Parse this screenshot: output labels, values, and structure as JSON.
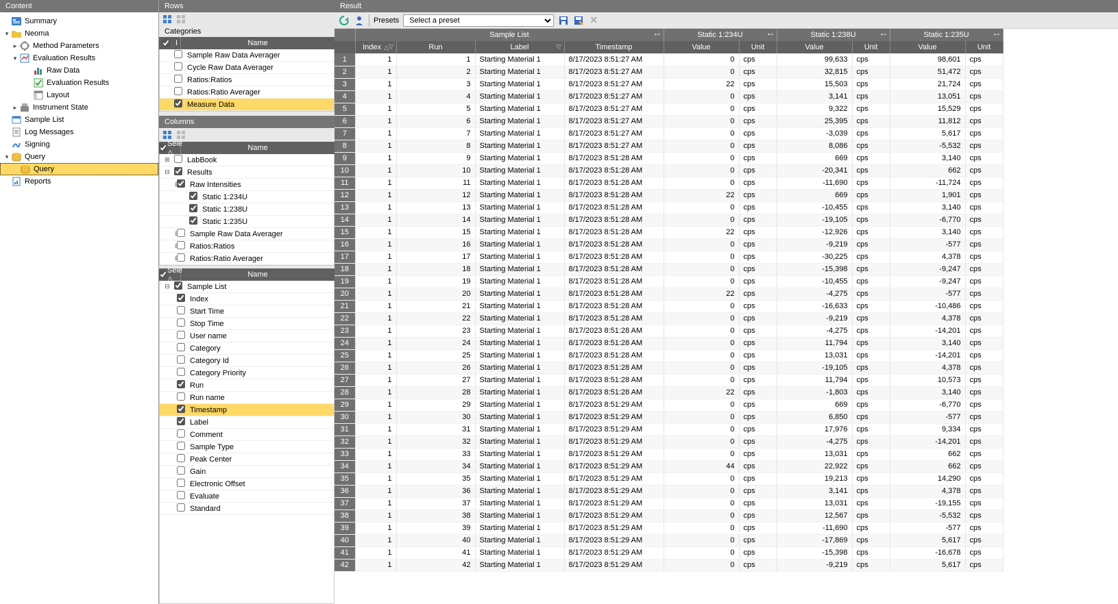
{
  "panels": {
    "content": "Content",
    "rows": "Rows",
    "columns": "Columns",
    "result": "Result"
  },
  "tree": [
    {
      "label": "Summary",
      "depth": 0,
      "icon": "summary",
      "toggle": ""
    },
    {
      "label": "Neoma",
      "depth": 0,
      "icon": "folder",
      "toggle": "▾"
    },
    {
      "label": "Method Parameters",
      "depth": 1,
      "icon": "params",
      "toggle": "▸"
    },
    {
      "label": "Evaluation Results",
      "depth": 1,
      "icon": "eval",
      "toggle": "▾"
    },
    {
      "label": "Raw Data",
      "depth": 2,
      "icon": "chart",
      "toggle": ""
    },
    {
      "label": "Evaluation Results",
      "depth": 2,
      "icon": "eval2",
      "toggle": ""
    },
    {
      "label": "Layout",
      "depth": 2,
      "icon": "layout",
      "toggle": ""
    },
    {
      "label": "Instrument State",
      "depth": 1,
      "icon": "instr",
      "toggle": "▸"
    },
    {
      "label": "Sample List",
      "depth": 0,
      "icon": "sample",
      "toggle": ""
    },
    {
      "label": "Log Messages",
      "depth": 0,
      "icon": "log",
      "toggle": ""
    },
    {
      "label": "Signing",
      "depth": 0,
      "icon": "sign",
      "toggle": ""
    },
    {
      "label": "Query",
      "depth": 0,
      "icon": "query",
      "toggle": "▾"
    },
    {
      "label": "Query",
      "depth": 1,
      "icon": "query2",
      "toggle": "",
      "selected": true
    },
    {
      "label": "Reports",
      "depth": 0,
      "icon": "report",
      "toggle": ""
    }
  ],
  "categories": {
    "title": "Categories",
    "header": {
      "check": "I",
      "name": "Name"
    },
    "rows": [
      {
        "label": "Sample Raw Data Averager",
        "checked": false,
        "sel": false
      },
      {
        "label": "Cycle Raw Data Averager",
        "checked": false,
        "sel": false
      },
      {
        "label": "Ratios:Ratios",
        "checked": false,
        "sel": false
      },
      {
        "label": "Ratios:Ratio Averager",
        "checked": false,
        "sel": false
      },
      {
        "label": "Measure Data",
        "checked": true,
        "sel": true
      }
    ]
  },
  "columns_top": {
    "header": {
      "check": "Sele △",
      "name": "Name"
    },
    "rows": [
      {
        "label": "LabBook",
        "checked": false,
        "expand": "+",
        "ind": 0
      },
      {
        "label": "Results",
        "checked": true,
        "expand": "−",
        "ind": 0
      },
      {
        "label": "Raw Intensities",
        "checked": true,
        "expand": "−",
        "ind": 1
      },
      {
        "label": "Static 1:234U",
        "checked": true,
        "expand": "",
        "ind": 2
      },
      {
        "label": "Static 1:238U",
        "checked": true,
        "expand": "",
        "ind": 2
      },
      {
        "label": "Static 1:235U",
        "checked": true,
        "expand": "",
        "ind": 2
      },
      {
        "label": "Sample Raw Data Averager",
        "checked": false,
        "expand": "+",
        "ind": 1
      },
      {
        "label": "Ratios:Ratios",
        "checked": false,
        "expand": "+",
        "ind": 1
      },
      {
        "label": "Ratios:Ratio Averager",
        "checked": false,
        "expand": "+",
        "ind": 1
      }
    ]
  },
  "columns_bot": {
    "header": {
      "check": "Sele △",
      "name": "Name"
    },
    "rows": [
      {
        "label": "Sample List",
        "checked": true,
        "expand": "−",
        "ind": 0,
        "sel": false
      },
      {
        "label": "Index",
        "checked": true,
        "expand": "",
        "ind": 1,
        "sel": false
      },
      {
        "label": "Start Time",
        "checked": false,
        "expand": "",
        "ind": 1,
        "sel": false
      },
      {
        "label": "Stop Time",
        "checked": false,
        "expand": "",
        "ind": 1,
        "sel": false
      },
      {
        "label": "User name",
        "checked": false,
        "expand": "",
        "ind": 1,
        "sel": false
      },
      {
        "label": "Category",
        "checked": false,
        "expand": "",
        "ind": 1,
        "sel": false
      },
      {
        "label": "Category Id",
        "checked": false,
        "expand": "",
        "ind": 1,
        "sel": false
      },
      {
        "label": "Category Priority",
        "checked": false,
        "expand": "",
        "ind": 1,
        "sel": false
      },
      {
        "label": "Run",
        "checked": true,
        "expand": "",
        "ind": 1,
        "sel": false
      },
      {
        "label": "Run name",
        "checked": false,
        "expand": "",
        "ind": 1,
        "sel": false
      },
      {
        "label": "Timestamp",
        "checked": true,
        "expand": "",
        "ind": 1,
        "sel": true
      },
      {
        "label": "Label",
        "checked": true,
        "expand": "",
        "ind": 1,
        "sel": false
      },
      {
        "label": "Comment",
        "checked": false,
        "expand": "",
        "ind": 1,
        "sel": false
      },
      {
        "label": "Sample Type",
        "checked": false,
        "expand": "",
        "ind": 1,
        "sel": false
      },
      {
        "label": "Peak Center",
        "checked": false,
        "expand": "",
        "ind": 1,
        "sel": false
      },
      {
        "label": "Gain",
        "checked": false,
        "expand": "",
        "ind": 1,
        "sel": false
      },
      {
        "label": "Electronic Offset",
        "checked": false,
        "expand": "",
        "ind": 1,
        "sel": false
      },
      {
        "label": "Evaluate",
        "checked": false,
        "expand": "",
        "ind": 1,
        "sel": false
      },
      {
        "label": "Standard",
        "checked": false,
        "expand": "",
        "ind": 1,
        "sel": false
      }
    ]
  },
  "toolbar": {
    "presets": "Presets",
    "placeholder": "Select a preset"
  },
  "groups": [
    "",
    "Sample List",
    "Static 1:234U",
    "Static 1:238U",
    "Static 1:235U"
  ],
  "cols": [
    "",
    "Index",
    "Run",
    "Label",
    "Timestamp",
    "Value",
    "Unit",
    "Value",
    "Unit",
    "Value",
    "Unit"
  ],
  "rows": [
    {
      "n": 1,
      "idx": 1,
      "run": 1,
      "label": "Starting Material 1",
      "ts": "8/17/2023 8:51:27 AM",
      "v234": "0",
      "u": "cps",
      "v238": "99,633",
      "v235": "98,601"
    },
    {
      "n": 2,
      "idx": 1,
      "run": 2,
      "label": "Starting Material 1",
      "ts": "8/17/2023 8:51:27 AM",
      "v234": "0",
      "u": "cps",
      "v238": "32,815",
      "v235": "51,472"
    },
    {
      "n": 3,
      "idx": 1,
      "run": 3,
      "label": "Starting Material 1",
      "ts": "8/17/2023 8:51:27 AM",
      "v234": "22",
      "u": "cps",
      "v238": "15,503",
      "v235": "21,724"
    },
    {
      "n": 4,
      "idx": 1,
      "run": 4,
      "label": "Starting Material 1",
      "ts": "8/17/2023 8:51:27 AM",
      "v234": "0",
      "u": "cps",
      "v238": "3,141",
      "v235": "13,051"
    },
    {
      "n": 5,
      "idx": 1,
      "run": 5,
      "label": "Starting Material 1",
      "ts": "8/17/2023 8:51:27 AM",
      "v234": "0",
      "u": "cps",
      "v238": "9,322",
      "v235": "15,529"
    },
    {
      "n": 6,
      "idx": 1,
      "run": 6,
      "label": "Starting Material 1",
      "ts": "8/17/2023 8:51:27 AM",
      "v234": "0",
      "u": "cps",
      "v238": "25,395",
      "v235": "11,812"
    },
    {
      "n": 7,
      "idx": 1,
      "run": 7,
      "label": "Starting Material 1",
      "ts": "8/17/2023 8:51:27 AM",
      "v234": "0",
      "u": "cps",
      "v238": "-3,039",
      "v235": "5,617"
    },
    {
      "n": 8,
      "idx": 1,
      "run": 8,
      "label": "Starting Material 1",
      "ts": "8/17/2023 8:51:27 AM",
      "v234": "0",
      "u": "cps",
      "v238": "8,086",
      "v235": "-5,532"
    },
    {
      "n": 9,
      "idx": 1,
      "run": 9,
      "label": "Starting Material 1",
      "ts": "8/17/2023 8:51:28 AM",
      "v234": "0",
      "u": "cps",
      "v238": "669",
      "v235": "3,140"
    },
    {
      "n": 10,
      "idx": 1,
      "run": 10,
      "label": "Starting Material 1",
      "ts": "8/17/2023 8:51:28 AM",
      "v234": "0",
      "u": "cps",
      "v238": "-20,341",
      "v235": "662"
    },
    {
      "n": 11,
      "idx": 1,
      "run": 11,
      "label": "Starting Material 1",
      "ts": "8/17/2023 8:51:28 AM",
      "v234": "0",
      "u": "cps",
      "v238": "-11,690",
      "v235": "-11,724"
    },
    {
      "n": 12,
      "idx": 1,
      "run": 12,
      "label": "Starting Material 1",
      "ts": "8/17/2023 8:51:28 AM",
      "v234": "22",
      "u": "cps",
      "v238": "669",
      "v235": "1,901"
    },
    {
      "n": 13,
      "idx": 1,
      "run": 13,
      "label": "Starting Material 1",
      "ts": "8/17/2023 8:51:28 AM",
      "v234": "0",
      "u": "cps",
      "v238": "-10,455",
      "v235": "3,140"
    },
    {
      "n": 14,
      "idx": 1,
      "run": 14,
      "label": "Starting Material 1",
      "ts": "8/17/2023 8:51:28 AM",
      "v234": "0",
      "u": "cps",
      "v238": "-19,105",
      "v235": "-6,770"
    },
    {
      "n": 15,
      "idx": 1,
      "run": 15,
      "label": "Starting Material 1",
      "ts": "8/17/2023 8:51:28 AM",
      "v234": "22",
      "u": "cps",
      "v238": "-12,926",
      "v235": "3,140"
    },
    {
      "n": 16,
      "idx": 1,
      "run": 16,
      "label": "Starting Material 1",
      "ts": "8/17/2023 8:51:28 AM",
      "v234": "0",
      "u": "cps",
      "v238": "-9,219",
      "v235": "-577"
    },
    {
      "n": 17,
      "idx": 1,
      "run": 17,
      "label": "Starting Material 1",
      "ts": "8/17/2023 8:51:28 AM",
      "v234": "0",
      "u": "cps",
      "v238": "-30,225",
      "v235": "4,378"
    },
    {
      "n": 18,
      "idx": 1,
      "run": 18,
      "label": "Starting Material 1",
      "ts": "8/17/2023 8:51:28 AM",
      "v234": "0",
      "u": "cps",
      "v238": "-15,398",
      "v235": "-9,247"
    },
    {
      "n": 19,
      "idx": 1,
      "run": 19,
      "label": "Starting Material 1",
      "ts": "8/17/2023 8:51:28 AM",
      "v234": "0",
      "u": "cps",
      "v238": "-10,455",
      "v235": "-9,247"
    },
    {
      "n": 20,
      "idx": 1,
      "run": 20,
      "label": "Starting Material 1",
      "ts": "8/17/2023 8:51:28 AM",
      "v234": "22",
      "u": "cps",
      "v238": "-4,275",
      "v235": "-577"
    },
    {
      "n": 21,
      "idx": 1,
      "run": 21,
      "label": "Starting Material 1",
      "ts": "8/17/2023 8:51:28 AM",
      "v234": "0",
      "u": "cps",
      "v238": "-16,633",
      "v235": "-10,486"
    },
    {
      "n": 22,
      "idx": 1,
      "run": 22,
      "label": "Starting Material 1",
      "ts": "8/17/2023 8:51:28 AM",
      "v234": "0",
      "u": "cps",
      "v238": "-9,219",
      "v235": "4,378"
    },
    {
      "n": 23,
      "idx": 1,
      "run": 23,
      "label": "Starting Material 1",
      "ts": "8/17/2023 8:51:28 AM",
      "v234": "0",
      "u": "cps",
      "v238": "-4,275",
      "v235": "-14,201"
    },
    {
      "n": 24,
      "idx": 1,
      "run": 24,
      "label": "Starting Material 1",
      "ts": "8/17/2023 8:51:28 AM",
      "v234": "0",
      "u": "cps",
      "v238": "11,794",
      "v235": "3,140"
    },
    {
      "n": 25,
      "idx": 1,
      "run": 25,
      "label": "Starting Material 1",
      "ts": "8/17/2023 8:51:28 AM",
      "v234": "0",
      "u": "cps",
      "v238": "13,031",
      "v235": "-14,201"
    },
    {
      "n": 26,
      "idx": 1,
      "run": 26,
      "label": "Starting Material 1",
      "ts": "8/17/2023 8:51:28 AM",
      "v234": "0",
      "u": "cps",
      "v238": "-19,105",
      "v235": "4,378"
    },
    {
      "n": 27,
      "idx": 1,
      "run": 27,
      "label": "Starting Material 1",
      "ts": "8/17/2023 8:51:28 AM",
      "v234": "0",
      "u": "cps",
      "v238": "11,794",
      "v235": "10,573"
    },
    {
      "n": 28,
      "idx": 1,
      "run": 28,
      "label": "Starting Material 1",
      "ts": "8/17/2023 8:51:28 AM",
      "v234": "22",
      "u": "cps",
      "v238": "-1,803",
      "v235": "3,140"
    },
    {
      "n": 29,
      "idx": 1,
      "run": 29,
      "label": "Starting Material 1",
      "ts": "8/17/2023 8:51:29 AM",
      "v234": "0",
      "u": "cps",
      "v238": "669",
      "v235": "-6,770"
    },
    {
      "n": 30,
      "idx": 1,
      "run": 30,
      "label": "Starting Material 1",
      "ts": "8/17/2023 8:51:29 AM",
      "v234": "0",
      "u": "cps",
      "v238": "6,850",
      "v235": "-577"
    },
    {
      "n": 31,
      "idx": 1,
      "run": 31,
      "label": "Starting Material 1",
      "ts": "8/17/2023 8:51:29 AM",
      "v234": "0",
      "u": "cps",
      "v238": "17,976",
      "v235": "9,334"
    },
    {
      "n": 32,
      "idx": 1,
      "run": 32,
      "label": "Starting Material 1",
      "ts": "8/17/2023 8:51:29 AM",
      "v234": "0",
      "u": "cps",
      "v238": "-4,275",
      "v235": "-14,201"
    },
    {
      "n": 33,
      "idx": 1,
      "run": 33,
      "label": "Starting Material 1",
      "ts": "8/17/2023 8:51:29 AM",
      "v234": "0",
      "u": "cps",
      "v238": "13,031",
      "v235": "662"
    },
    {
      "n": 34,
      "idx": 1,
      "run": 34,
      "label": "Starting Material 1",
      "ts": "8/17/2023 8:51:29 AM",
      "v234": "44",
      "u": "cps",
      "v238": "22,922",
      "v235": "662"
    },
    {
      "n": 35,
      "idx": 1,
      "run": 35,
      "label": "Starting Material 1",
      "ts": "8/17/2023 8:51:29 AM",
      "v234": "0",
      "u": "cps",
      "v238": "19,213",
      "v235": "14,290"
    },
    {
      "n": 36,
      "idx": 1,
      "run": 36,
      "label": "Starting Material 1",
      "ts": "8/17/2023 8:51:29 AM",
      "v234": "0",
      "u": "cps",
      "v238": "3,141",
      "v235": "4,378"
    },
    {
      "n": 37,
      "idx": 1,
      "run": 37,
      "label": "Starting Material 1",
      "ts": "8/17/2023 8:51:29 AM",
      "v234": "0",
      "u": "cps",
      "v238": "13,031",
      "v235": "-19,155"
    },
    {
      "n": 38,
      "idx": 1,
      "run": 38,
      "label": "Starting Material 1",
      "ts": "8/17/2023 8:51:29 AM",
      "v234": "0",
      "u": "cps",
      "v238": "12,567",
      "v235": "-5,532"
    },
    {
      "n": 39,
      "idx": 1,
      "run": 39,
      "label": "Starting Material 1",
      "ts": "8/17/2023 8:51:29 AM",
      "v234": "0",
      "u": "cps",
      "v238": "-11,690",
      "v235": "-577"
    },
    {
      "n": 40,
      "idx": 1,
      "run": 40,
      "label": "Starting Material 1",
      "ts": "8/17/2023 8:51:29 AM",
      "v234": "0",
      "u": "cps",
      "v238": "-17,869",
      "v235": "5,617"
    },
    {
      "n": 41,
      "idx": 1,
      "run": 41,
      "label": "Starting Material 1",
      "ts": "8/17/2023 8:51:29 AM",
      "v234": "0",
      "u": "cps",
      "v238": "-15,398",
      "v235": "-16,678"
    },
    {
      "n": 42,
      "idx": 1,
      "run": 42,
      "label": "Starting Material 1",
      "ts": "8/17/2023 8:51:29 AM",
      "v234": "0",
      "u": "cps",
      "v238": "-9,219",
      "v235": "5,617"
    }
  ]
}
